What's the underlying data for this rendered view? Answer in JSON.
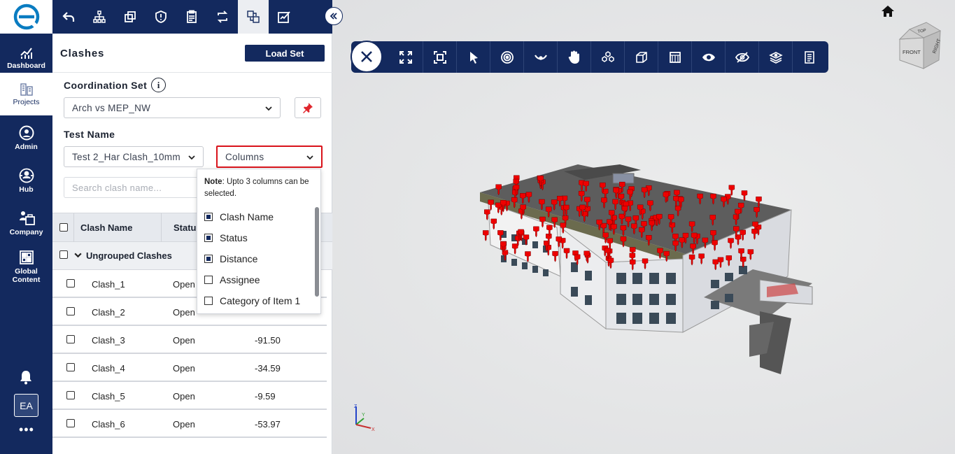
{
  "sidebar": {
    "logo_icon": "e-logo",
    "items": [
      {
        "label": "Dashboard",
        "icon": "chart-icon"
      },
      {
        "label": "Projects",
        "icon": "buildings-icon"
      },
      {
        "label": "Admin",
        "icon": "admin-icon"
      },
      {
        "label": "Hub",
        "icon": "hub-icon"
      },
      {
        "label": "Company",
        "icon": "company-icon"
      },
      {
        "label": "Global Content",
        "icon": "global-content-icon"
      }
    ],
    "avatar_initials": "EA",
    "more_label": "•••"
  },
  "panel": {
    "title": "Clashes",
    "load_set_label": "Load Set",
    "coordination_set_label": "Coordination Set",
    "coordination_set_value": "Arch vs MEP_NW",
    "test_name_label": "Test Name",
    "test_name_value": "Test 2_Har Clash_10mm",
    "columns_label": "Columns",
    "search_placeholder": "Search clash name..."
  },
  "columns_dropdown": {
    "note_bold": "Note",
    "note_text": ": Upto 3 columns can be selected.",
    "options": [
      {
        "label": "Clash Name",
        "checked": true
      },
      {
        "label": "Status",
        "checked": true
      },
      {
        "label": "Distance",
        "checked": true
      },
      {
        "label": "Assignee",
        "checked": false
      },
      {
        "label": "Category of Item 1",
        "checked": false
      }
    ]
  },
  "table": {
    "headers": [
      "Clash Name",
      "Status"
    ],
    "group_label": "Ungrouped Clashes",
    "rows": [
      {
        "name": "Clash_1",
        "status": "Open",
        "distance": ""
      },
      {
        "name": "Clash_2",
        "status": "Open",
        "distance": ""
      },
      {
        "name": "Clash_3",
        "status": "Open",
        "distance": "-91.50"
      },
      {
        "name": "Clash_4",
        "status": "Open",
        "distance": "-34.59"
      },
      {
        "name": "Clash_5",
        "status": "Open",
        "distance": "-9.59"
      },
      {
        "name": "Clash_6",
        "status": "Open",
        "distance": "-53.97"
      }
    ]
  },
  "viewer": {
    "view_cube_faces": [
      "TOP",
      "FRONT",
      "RIGHT"
    ],
    "axis_labels": [
      "Z",
      "Y",
      "X"
    ],
    "clash_marker_color": "#ee0000"
  },
  "colors": {
    "navy": "#13295e",
    "highlight_red": "#d9131b"
  }
}
